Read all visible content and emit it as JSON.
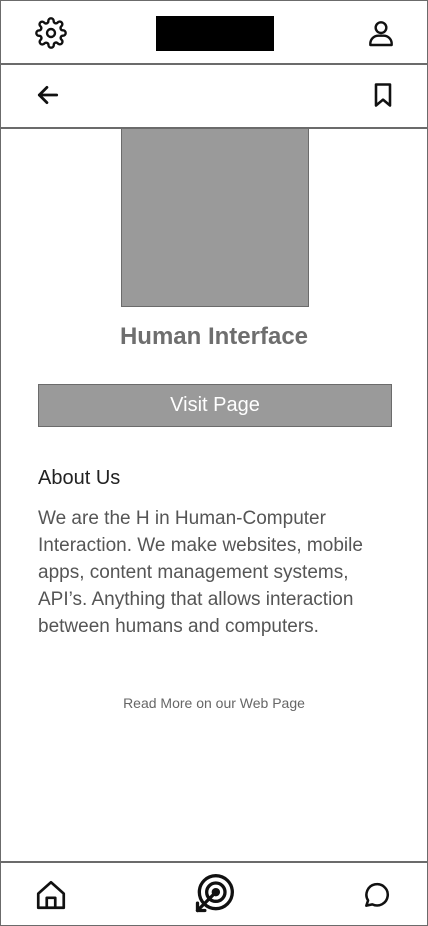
{
  "header": {
    "settings_icon": "gear-icon",
    "profile_icon": "user-icon",
    "logo": "redacted-logo"
  },
  "subheader": {
    "back_icon": "arrow-left-icon",
    "bookmark_icon": "bookmark-icon"
  },
  "profile": {
    "title": "Human Interface",
    "visit_button_label": "Visit Page"
  },
  "about": {
    "heading": "About Us",
    "body": "We are the H in Human-Computer Interaction. We make websites, mobile apps, content management systems, API’s. Anything that allows interaction between humans and computers.",
    "read_more_label": "Read More on our Web Page"
  },
  "bottom_nav": {
    "home_icon": "home-icon",
    "target_icon": "target-icon",
    "chat_icon": "chat-icon"
  },
  "colors": {
    "border": "#6b6b6b",
    "placeholder": "#9a9a9a",
    "logo": "#000000"
  }
}
